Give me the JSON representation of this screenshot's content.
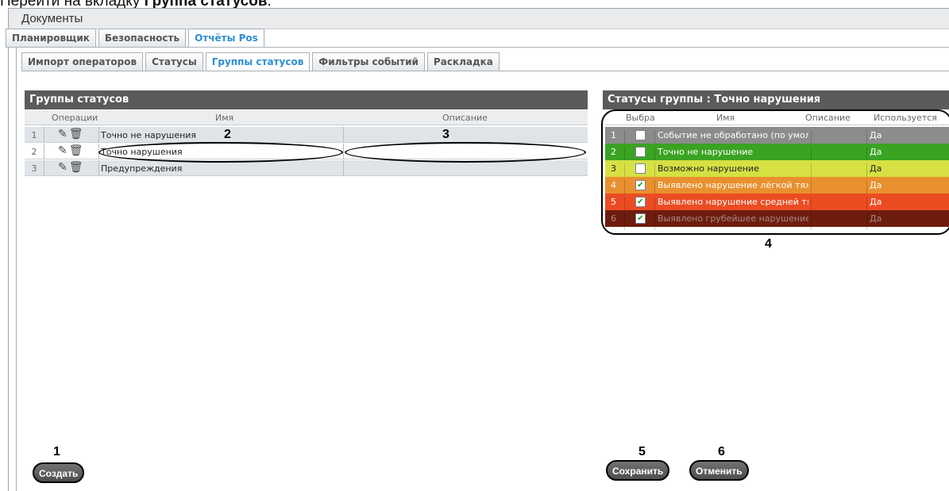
{
  "intro": {
    "text_before": "Перейти на вкладку ",
    "text_bold": "Группа статусов",
    "text_after": "."
  },
  "window": {
    "title": "Документы"
  },
  "main_tabs": [
    {
      "label": "Планировщик",
      "active": false
    },
    {
      "label": "Безопасность",
      "active": false
    },
    {
      "label": "Отчёты Pos",
      "active": true
    }
  ],
  "sub_tabs": [
    {
      "label": "Импорт операторов",
      "active": false
    },
    {
      "label": "Статусы",
      "active": false
    },
    {
      "label": "Группы статусов",
      "active": true
    },
    {
      "label": "Фильтры событий",
      "active": false
    },
    {
      "label": "Раскладка",
      "active": false
    }
  ],
  "groups_panel": {
    "title": "Группы статусов",
    "columns": {
      "operations": "Операции",
      "name": "Имя",
      "description": "Описание"
    },
    "rows": [
      {
        "num": "1",
        "name": "Точно не нарушения",
        "description": ""
      },
      {
        "num": "2",
        "name": "Точно нарушения",
        "description": ""
      },
      {
        "num": "3",
        "name": "Предупреждения",
        "description": ""
      }
    ]
  },
  "statuses_panel": {
    "title": "Статусы группы : Точно нарушения",
    "columns": {
      "select": "Выбра",
      "name": "Имя",
      "description": "Описание",
      "used": "Используется"
    },
    "rows": [
      {
        "num": "1",
        "checked": false,
        "name": "Событие не обработано (по умол",
        "description": "",
        "used": "Да",
        "color": "#8c8c8c",
        "text_color": "#ffffff"
      },
      {
        "num": "2",
        "checked": false,
        "name": "Точно не нарушение",
        "description": "",
        "used": "Да",
        "color": "#3aa322",
        "text_color": "#ffffff"
      },
      {
        "num": "3",
        "checked": false,
        "name": "Возможно нарушение",
        "description": "",
        "used": "Да",
        "color": "#d7e043",
        "text_color": "#222222"
      },
      {
        "num": "4",
        "checked": true,
        "name": "Выявлено нарушение лёгкой тяж",
        "description": "",
        "used": "Да",
        "color": "#e9902e",
        "text_color": "#ffffff"
      },
      {
        "num": "5",
        "checked": true,
        "name": "Выявлено нарушение средней тя",
        "description": "",
        "used": "Да",
        "color": "#ec4c22",
        "text_color": "#ffffff"
      },
      {
        "num": "6",
        "checked": true,
        "name": "Выявлено грубейшее нарушение",
        "description": "",
        "used": "Да",
        "color": "#6e1c0e",
        "text_color": "#a58a84"
      }
    ]
  },
  "buttons": {
    "create": "Создать",
    "save": "Сохранить",
    "cancel": "Отменить"
  },
  "callouts": {
    "c1": "1",
    "c2": "2",
    "c3": "3",
    "c4": "4",
    "c5": "5",
    "c6": "6"
  }
}
